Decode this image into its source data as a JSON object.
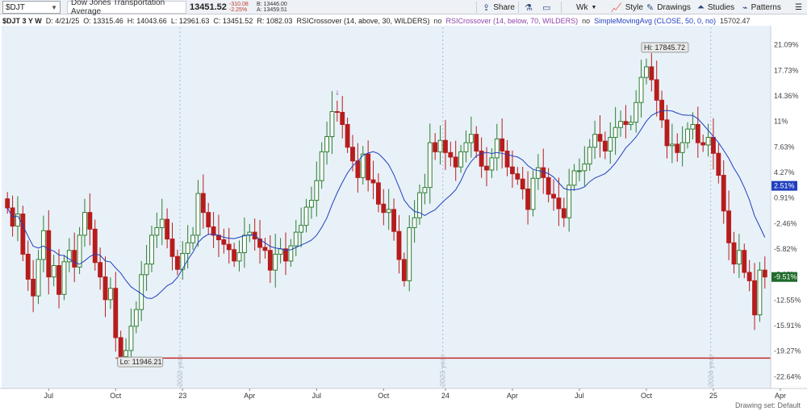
{
  "toolbar": {
    "symbol": "$DJT",
    "name": "Dow Jones Transportation Average",
    "last": "13451.52",
    "change": "-310.08",
    "change_pct": "-2.25%",
    "bid": "B: 13446.00",
    "ask": "A: 13459.51",
    "share": "Share",
    "timeframe": "Wk",
    "style": "Style",
    "drawings": "Drawings",
    "studies": "Studies",
    "patterns": "Patterns",
    "accent": "#2a4a7f"
  },
  "infoline": {
    "symbol_period": "$DJT 3 Y W",
    "date": "D: 4/21/25",
    "open": "O: 13315.46",
    "high": "H: 14043.66",
    "low": "L: 12961.63",
    "close": "C: 13451.52",
    "range": "R: 1082.03",
    "rsi1": "RSICrossover (14, above, 30, WILDERS)",
    "rsi1_val": "no",
    "rsi2": "RSICrossover (14, below, 70, WILDERS)",
    "rsi2_val": "no",
    "sma": "SimpleMovingAvg (CLOSE, 50, 0, no)",
    "sma_val": "15702.47"
  },
  "footer": "Drawing set: Default",
  "chart_data": {
    "type": "candlestick",
    "y_axis_unit": "percent",
    "y_ticks": [
      21.09,
      17.73,
      14.36,
      11,
      7.63,
      4.27,
      0.91,
      -2.46,
      -5.82,
      -9.18,
      -12.55,
      -15.91,
      -19.27,
      -22.64
    ],
    "y_tick_labels": [
      "21.09%",
      "17.73%",
      "14.36%",
      "11%",
      "7.63%",
      "4.27%",
      "0.91%",
      "-2.46%",
      "-5.82%",
      "-9.18%",
      "-12.55%",
      "-15.91%",
      "-19.27%",
      "-22.64%"
    ],
    "ylim": [
      -24.2,
      23.4
    ],
    "x_tick_labels": [
      "Jul",
      "Oct",
      "23",
      "Apr",
      "Jul",
      "Oct",
      "24",
      "Apr",
      "Jul",
      "Oct",
      "25",
      "Apr"
    ],
    "x_tick_index": [
      8,
      21,
      34,
      47,
      60,
      73,
      85,
      98,
      111,
      124,
      137,
      150
    ],
    "year_markers": [
      {
        "label": "2022 year",
        "index": 34
      },
      {
        "label": "2023 year",
        "index": 85
      },
      {
        "label": "2024 year",
        "index": 137
      }
    ],
    "badge_current": {
      "label": "-9.51%",
      "value": -9.51,
      "color": "#1e6b2a"
    },
    "badge_sma": {
      "label": "2.51%",
      "value": 2.51,
      "color": "#1f3fbf"
    },
    "hi_label": "Hi: 17845.72",
    "hi_value": 19.7,
    "lo_label": "Lo: 11946.21",
    "lo_value": -19.75,
    "lo_line": -20.2,
    "rsi_arrow_index": 64,
    "up_color": "#2e7d32",
    "down_color": "#b71c1c",
    "sma_color": "#1f3fbf",
    "closes": [
      -0.4,
      -2.8,
      -1.2,
      -6.5,
      -9.8,
      -12.0,
      -7.2,
      -3.4,
      -9.5,
      -8.0,
      -11.8,
      -7.5,
      -6.0,
      -8.2,
      -4.0,
      -1.0,
      -3.2,
      -7.6,
      -9.5,
      -12.5,
      -11.0,
      -17.5,
      -20.0,
      -19.2,
      -16.0,
      -13.8,
      -9.2,
      -7.8,
      -4.0,
      -3.0,
      -1.9,
      -4.5,
      -6.8,
      -8.5,
      -6.4,
      -5.0,
      -4.0,
      1.5,
      -1.0,
      -2.9,
      -4.0,
      -4.6,
      -5.2,
      -5.9,
      -7.4,
      -6.3,
      -4.0,
      -3.6,
      -4.5,
      -5.6,
      -6.0,
      -8.6,
      -6.5,
      -5.8,
      -7.4,
      -5.4,
      -3.6,
      -2.7,
      -0.3,
      0.6,
      3.2,
      7.0,
      9.0,
      12.3,
      12.2,
      10.6,
      7.6,
      5.8,
      3.6,
      6.7,
      3.3,
      2.9,
      0.1,
      -1.0,
      -0.6,
      -3.5,
      -7.2,
      -10.0,
      -3.0,
      -1.7,
      1.6,
      2.3,
      8.2,
      7.0,
      8.5,
      6.9,
      6.3,
      5.0,
      7.0,
      8.2,
      9.3,
      7.1,
      5.1,
      4.6,
      6.2,
      8.7,
      7.1,
      5.0,
      4.1,
      3.4,
      2.1,
      -0.6,
      3.5,
      4.9,
      3.6,
      1.4,
      0.9,
      -0.5,
      -1.7,
      2.6,
      4.5,
      4.5,
      5.4,
      7.6,
      9.3,
      8.4,
      7.1,
      8.9,
      10.2,
      11.0,
      10.6,
      10.9,
      13.5,
      16.8,
      18.2,
      16.5,
      13.8,
      11.2,
      7.8,
      8.0,
      6.9,
      8.2,
      10.0,
      10.6,
      8.2,
      7.9,
      8.9,
      6.8,
      3.9,
      -0.8,
      -5.0,
      -7.8,
      -6.0,
      -8.9,
      -10.0,
      -14.5,
      -8.6,
      -9.5
    ]
  }
}
